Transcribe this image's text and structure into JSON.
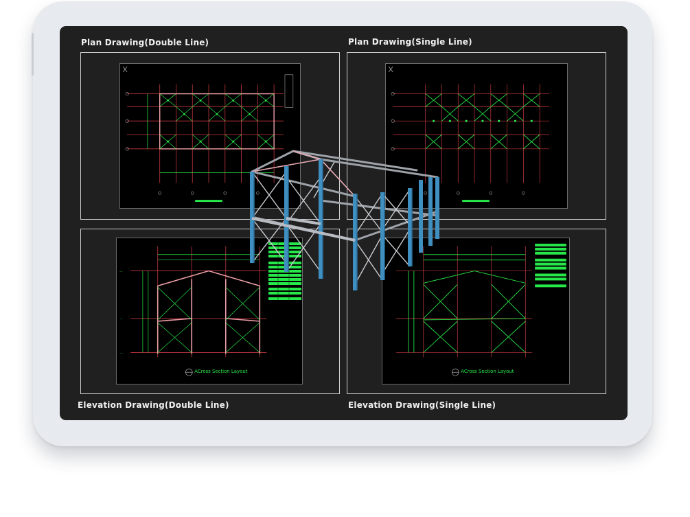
{
  "panels": {
    "plan_double": {
      "title": "Plan Drawing(Double Line)"
    },
    "plan_single": {
      "title": "Plan Drawing(Single Line)"
    },
    "elevation_double": {
      "title": "Elevation Drawing(Double Line)",
      "caption": "ACross Section Layout"
    },
    "elevation_single": {
      "title": "Elevation Drawing(Single Line)",
      "caption": "ACross Section Layout"
    }
  },
  "colors": {
    "device_bezel": "#e7eaef",
    "screen_bg": "#202020",
    "cad_bg": "#000000",
    "cad_green": "#27e84a",
    "cad_red": "#c8383e",
    "steel_blue": "#3f8fc0",
    "steel_grey": "#b8bcc2"
  },
  "icons": {
    "frame_3d": "steel-frame-3d-model-icon"
  }
}
